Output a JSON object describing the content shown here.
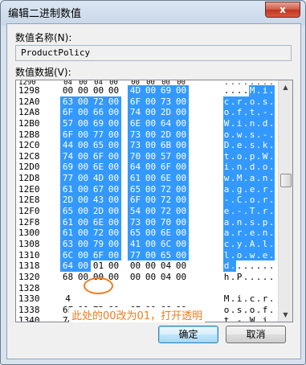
{
  "window": {
    "title": "编辑二进制数值",
    "close_label": "x"
  },
  "value_name": {
    "label": "数值名称(N):",
    "value": "ProductPolicy"
  },
  "value_data": {
    "label": "数值数据(V):"
  },
  "hex_rows": [
    {
      "addr": "1290",
      "bytes": [
        "04",
        "00",
        "04",
        "00",
        "00",
        "00",
        "00",
        "00"
      ],
      "ascii": "........"
    },
    {
      "addr": "1298",
      "bytes": [
        "00",
        "00",
        "00",
        "00",
        "4D",
        "00",
        "69",
        "00"
      ],
      "ascii": "....M.i."
    },
    {
      "addr": "12A0",
      "bytes": [
        "63",
        "00",
        "72",
        "00",
        "6F",
        "00",
        "73",
        "00"
      ],
      "ascii": "c.r.o.s."
    },
    {
      "addr": "12A8",
      "bytes": [
        "6F",
        "00",
        "66",
        "00",
        "74",
        "00",
        "2D",
        "00"
      ],
      "ascii": "o.f.t.-."
    },
    {
      "addr": "12B0",
      "bytes": [
        "57",
        "00",
        "69",
        "00",
        "6E",
        "00",
        "64",
        "00"
      ],
      "ascii": "W.i.n.d."
    },
    {
      "addr": "12B8",
      "bytes": [
        "6F",
        "00",
        "77",
        "00",
        "73",
        "00",
        "2D",
        "00"
      ],
      "ascii": "o.w.s.-."
    },
    {
      "addr": "12C0",
      "bytes": [
        "44",
        "00",
        "65",
        "00",
        "73",
        "00",
        "6B",
        "00"
      ],
      "ascii": "D.e.s.k."
    },
    {
      "addr": "12C8",
      "bytes": [
        "74",
        "00",
        "6F",
        "00",
        "70",
        "00",
        "57",
        "00"
      ],
      "ascii": "t.o.p.W."
    },
    {
      "addr": "12D0",
      "bytes": [
        "69",
        "00",
        "6E",
        "00",
        "64",
        "00",
        "6F",
        "00"
      ],
      "ascii": "i.n.d.o."
    },
    {
      "addr": "12D8",
      "bytes": [
        "77",
        "00",
        "4D",
        "00",
        "61",
        "00",
        "6E",
        "00"
      ],
      "ascii": "w.M.a.n."
    },
    {
      "addr": "12E0",
      "bytes": [
        "61",
        "00",
        "67",
        "00",
        "65",
        "00",
        "72",
        "00"
      ],
      "ascii": "a.g.e.r."
    },
    {
      "addr": "12E8",
      "bytes": [
        "2D",
        "00",
        "43",
        "00",
        "6F",
        "00",
        "72",
        "00"
      ],
      "ascii": "-.C.o.r."
    },
    {
      "addr": "12F0",
      "bytes": [
        "65",
        "00",
        "2D",
        "00",
        "54",
        "00",
        "72",
        "00"
      ],
      "ascii": "e.-.T.r."
    },
    {
      "addr": "12F8",
      "bytes": [
        "61",
        "00",
        "6E",
        "00",
        "73",
        "00",
        "70",
        "00"
      ],
      "ascii": "a.n.s.p."
    },
    {
      "addr": "1300",
      "bytes": [
        "61",
        "00",
        "72",
        "00",
        "65",
        "00",
        "6E",
        "00"
      ],
      "ascii": "a.r.e.n."
    },
    {
      "addr": "1308",
      "bytes": [
        "63",
        "00",
        "79",
        "00",
        "41",
        "00",
        "6C",
        "00"
      ],
      "ascii": "c.y.A.l."
    },
    {
      "addr": "1310",
      "bytes": [
        "6C",
        "00",
        "6F",
        "00",
        "77",
        "00",
        "65",
        "00"
      ],
      "ascii": "l.o.w.e."
    },
    {
      "addr": "1318",
      "bytes": [
        "64",
        "00",
        "01",
        "00",
        "00",
        "00",
        "04",
        "00"
      ],
      "ascii": "d......."
    },
    {
      "addr": "1320",
      "bytes": [
        "68",
        "00",
        "00",
        "00",
        "00",
        "00",
        "04",
        "00"
      ],
      "ascii": "h.P....."
    },
    {
      "addr": "1328",
      "bytes": [
        "",
        "",
        "",
        "",
        "",
        "",
        "",
        ""
      ],
      "ascii": ""
    },
    {
      "addr": "1330",
      "bytes": [
        "4",
        "",
        "",
        "",
        "",
        "",
        "",
        ""
      ],
      "ascii": "M.i.c.r."
    },
    {
      "addr": "1338",
      "bytes": [
        "6F",
        "00",
        "73",
        "00",
        "6F",
        "00",
        "66",
        "00"
      ],
      "ascii": "o.s.o.f."
    },
    {
      "addr": "1340",
      "bytes": [
        "74",
        "00",
        "2D",
        "00",
        "57",
        "00",
        "69",
        "00"
      ],
      "ascii": "t.-.W.i."
    }
  ],
  "annotation": "此处的00改为01，打开透明",
  "buttons": {
    "ok": "确定",
    "cancel": "取消"
  },
  "colors": {
    "selection": "#3399ff",
    "annotation": "#f07b1e"
  }
}
